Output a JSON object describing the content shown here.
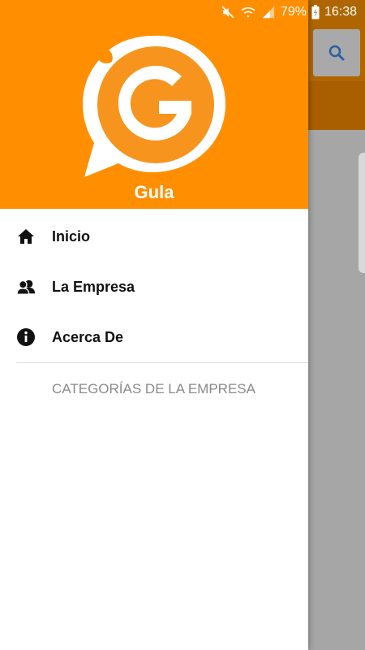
{
  "status_bar": {
    "battery_percent": "79%",
    "time": "16:38",
    "icons": [
      "mute-icon",
      "wifi-icon",
      "signal-icon",
      "battery-charging-icon"
    ]
  },
  "drawer": {
    "app_name": "Gula",
    "menu": [
      {
        "label": "Inicio",
        "icon": "home-icon"
      },
      {
        "label": "La Empresa",
        "icon": "people-icon"
      },
      {
        "label": "Acerca De",
        "icon": "info-icon"
      }
    ],
    "section_title": "CATEGORÍAS DE LA EMPRESA"
  },
  "background": {
    "search_icon": "search-icon"
  },
  "colors": {
    "accent": "#ff8f00",
    "dim_overlay": "#a6a6a6",
    "search_blue": "#2e5fa8"
  }
}
